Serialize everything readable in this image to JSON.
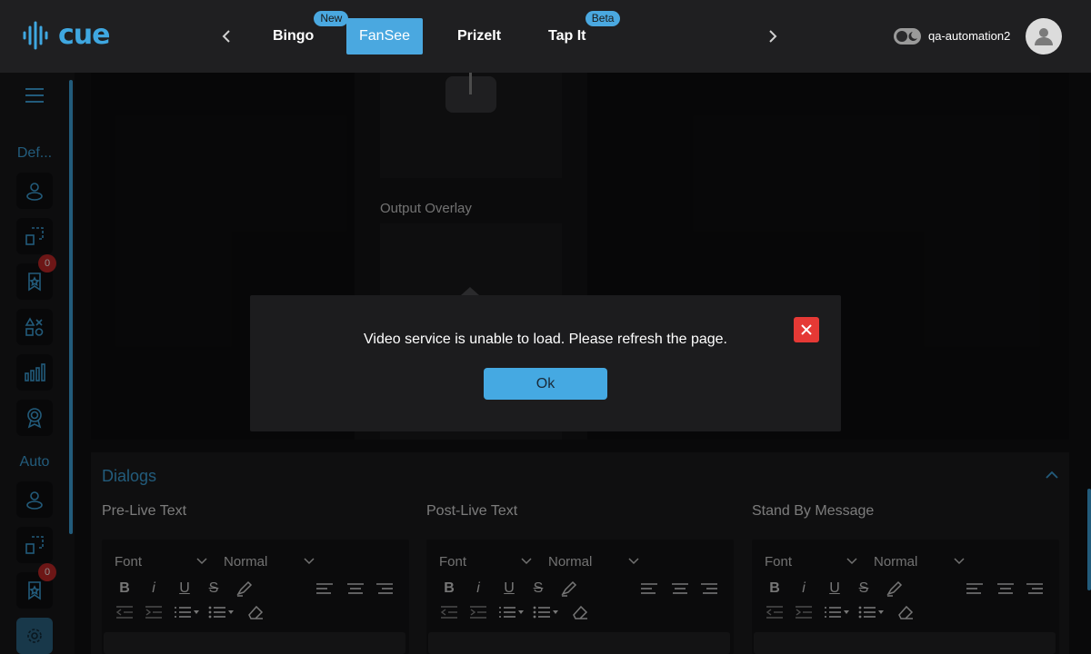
{
  "header": {
    "logo_text": "cue",
    "tabs": [
      {
        "label": "Bingo",
        "badge": "New"
      },
      {
        "label": "FanSee",
        "badge": ""
      },
      {
        "label": "PrizeIt",
        "badge": ""
      },
      {
        "label": "Tap It",
        "badge": "Beta"
      }
    ],
    "active_tab": "FanSee",
    "username": "qa-automation2"
  },
  "sidebar": {
    "section_default": "Def...",
    "section_auto": "Auto",
    "default_items": [
      {
        "icon": "user-icon"
      },
      {
        "icon": "copy-icon"
      },
      {
        "icon": "bookmark-star-icon",
        "badge": "0"
      },
      {
        "icon": "shapes-icon"
      },
      {
        "icon": "bar-chart-icon"
      },
      {
        "icon": "award-icon"
      }
    ],
    "auto_items": [
      {
        "icon": "user-icon"
      },
      {
        "icon": "copy-icon"
      },
      {
        "icon": "bookmark-star-icon",
        "badge": "0"
      },
      {
        "icon": "settings-icon"
      }
    ]
  },
  "video": {
    "output_overlay_label": "Output Overlay"
  },
  "dialogs": {
    "title": "Dialogs",
    "columns": [
      {
        "title": "Pre-Live Text",
        "font": "Font",
        "size": "Normal"
      },
      {
        "title": "Post-Live Text",
        "font": "Font",
        "size": "Normal"
      },
      {
        "title": "Stand By Message",
        "font": "Font",
        "size": "Normal"
      }
    ]
  },
  "modal": {
    "message": "Video service is unable to load. Please refresh the page.",
    "ok_label": "Ok"
  },
  "colors": {
    "accent": "#3fa7e0",
    "danger": "#e53935",
    "background": "#111113"
  }
}
